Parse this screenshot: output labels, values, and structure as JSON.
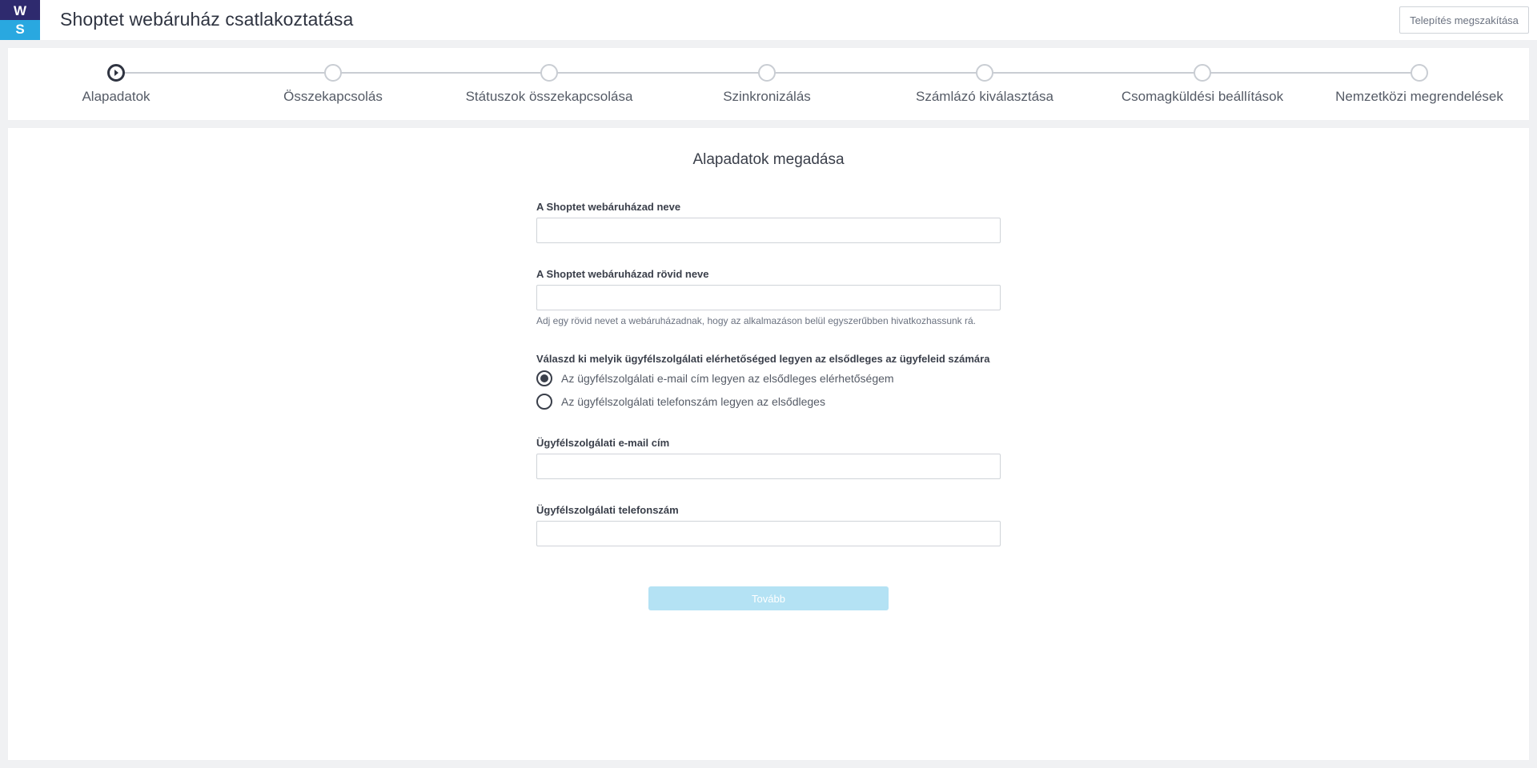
{
  "header": {
    "logo_top": "W",
    "logo_bottom": "S",
    "title": "Shoptet webáruház csatlakoztatása",
    "cancel_label": "Telepítés megszakítása"
  },
  "stepper": {
    "active_index": 0,
    "steps": [
      {
        "label": "Alapadatok"
      },
      {
        "label": "Összekapcsolás"
      },
      {
        "label": "Státuszok összekapcsolása"
      },
      {
        "label": "Szinkronizálás"
      },
      {
        "label": "Számlázó kiválasztása"
      },
      {
        "label": "Csomagküldési beállítások"
      },
      {
        "label": "Nemzetközi megrendelések"
      }
    ]
  },
  "form": {
    "title": "Alapadatok megadása",
    "shop_name": {
      "label": "A Shoptet webáruházad neve",
      "value": ""
    },
    "shop_short_name": {
      "label": "A Shoptet webáruházad rövid neve",
      "value": "",
      "hint": "Adj egy rövid nevet a webáruházadnak, hogy az alkalmazáson belül egyszerűbben hivatkozhassunk rá."
    },
    "primary_contact": {
      "label": "Válaszd ki melyik ügyfélszolgálati elérhetőséged legyen az elsődleges az ügyfeleid számára",
      "options": [
        {
          "label": "Az ügyfélszolgálati e-mail cím legyen az elsődleges elérhetőségem",
          "checked": true
        },
        {
          "label": "Az ügyfélszolgálati telefonszám legyen az elsődleges",
          "checked": false
        }
      ]
    },
    "support_email": {
      "label": "Ügyfélszolgálati e-mail cím",
      "value": ""
    },
    "support_phone": {
      "label": "Ügyfélszolgálati telefonszám",
      "value": ""
    },
    "next_label": "Tovább"
  },
  "colors": {
    "logo_top": "#2e2a6e",
    "logo_bottom": "#29a8e0",
    "next_button_disabled": "#b4e2f4",
    "text_dark": "#2f3441"
  }
}
